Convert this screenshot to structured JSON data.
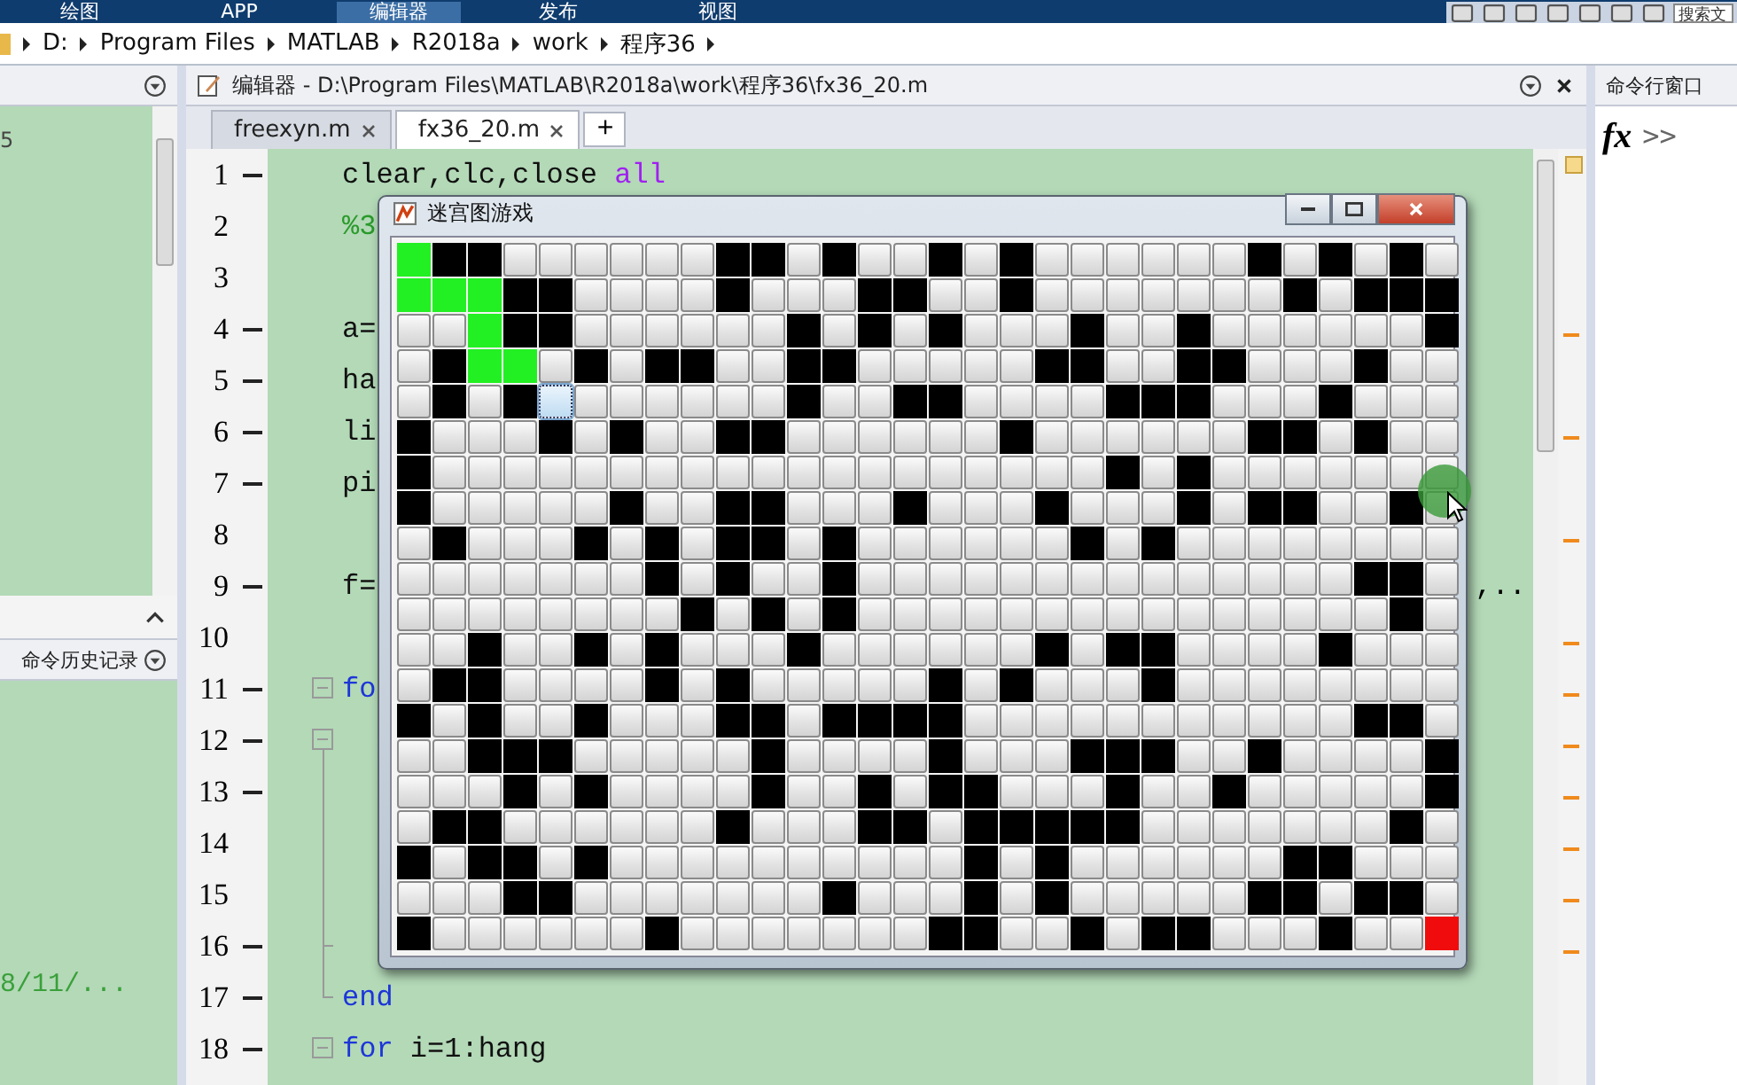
{
  "ribbon": {
    "tabs": [
      {
        "label": "绘图",
        "selected": false
      },
      {
        "label": "APP",
        "selected": false
      },
      {
        "label": "编辑器",
        "selected": true
      },
      {
        "label": "发布",
        "selected": false
      },
      {
        "label": "视图",
        "selected": false
      }
    ],
    "search": {
      "placeholder": "搜索文"
    }
  },
  "address_bar": {
    "segments": [
      "D:",
      "Program Files",
      "MATLAB",
      "R2018a",
      "work",
      "程序36"
    ]
  },
  "current_folder": {
    "texts": [
      "5"
    ]
  },
  "command_history": {
    "title": "命令历史记录",
    "texts": [
      "8/11/..."
    ]
  },
  "editor": {
    "title": "编辑器 - D:\\Program Files\\MATLAB\\R2018a\\work\\程序36\\fx36_20.m",
    "tabs": [
      {
        "label": "freexyn.m",
        "selected": false
      },
      {
        "label": "fx36_20.m",
        "selected": true
      }
    ],
    "add_tab": "+",
    "lines": [
      {
        "number": "1",
        "executable": true,
        "tokens": [
          {
            "kind": "plain",
            "text": "clear,clc,close "
          },
          {
            "kind": "string",
            "text": "all"
          }
        ]
      },
      {
        "number": "2",
        "executable": false,
        "tokens": [
          {
            "kind": "comment",
            "text": "%3"
          }
        ]
      },
      {
        "number": "3",
        "executable": false
      },
      {
        "number": "4",
        "executable": true,
        "tokens": [
          {
            "kind": "plain",
            "text": "a="
          }
        ]
      },
      {
        "number": "5",
        "executable": true,
        "tokens": [
          {
            "kind": "plain",
            "text": "ha"
          }
        ]
      },
      {
        "number": "6",
        "executable": true,
        "tokens": [
          {
            "kind": "plain",
            "text": "li"
          }
        ]
      },
      {
        "number": "7",
        "executable": true,
        "tokens": [
          {
            "kind": "plain",
            "text": "pi"
          }
        ]
      },
      {
        "number": "8",
        "executable": false
      },
      {
        "number": "9",
        "executable": true,
        "tokens": [
          {
            "kind": "plain",
            "text": "f="
          }
        ],
        "tail": ",.."
      },
      {
        "number": "10",
        "executable": false
      },
      {
        "number": "11",
        "executable": true,
        "kind": "fold_start",
        "tokens": [
          {
            "kind": "keyword",
            "text": "fo"
          }
        ]
      },
      {
        "number": "12",
        "executable": true,
        "kind": "fold_start"
      },
      {
        "number": "13",
        "executable": true,
        "kind": "fold_line"
      },
      {
        "number": "14",
        "executable": false,
        "kind": "fold_line"
      },
      {
        "number": "15",
        "executable": false,
        "kind": "fold_line"
      },
      {
        "number": "16",
        "executable": true,
        "kind": "fold_branch"
      },
      {
        "number": "17",
        "executable": true,
        "kind": "fold_end",
        "tokens": [
          {
            "kind": "keyword",
            "text": "end"
          }
        ]
      },
      {
        "number": "18",
        "executable": true,
        "kind": "fold_start",
        "tokens": [
          {
            "kind": "keyword",
            "text": "for"
          },
          {
            "kind": "plain",
            "text": " i=1:hang"
          }
        ]
      }
    ]
  },
  "command_window": {
    "title": "命令行窗口",
    "fx": "fx",
    "prompt": ">>"
  },
  "maze_window": {
    "title": "迷宫图游戏",
    "rows": [
      {
        "cells": [
          {
            "kind": "visited"
          },
          {
            "kind": "wall"
          },
          {
            "kind": "wall"
          },
          {
            "kind": "open"
          },
          {
            "kind": "open"
          },
          {
            "kind": "open"
          },
          {
            "kind": "open"
          },
          {
            "kind": "open"
          },
          {
            "kind": "open"
          },
          {
            "kind": "wall"
          },
          {
            "kind": "wall"
          },
          {
            "kind": "open"
          },
          {
            "kind": "wall"
          },
          {
            "kind": "open"
          },
          {
            "kind": "open"
          },
          {
            "kind": "wall"
          },
          {
            "kind": "open"
          },
          {
            "kind": "wall"
          },
          {
            "kind": "open"
          },
          {
            "kind": "open"
          },
          {
            "kind": "open"
          },
          {
            "kind": "open"
          },
          {
            "kind": "open"
          },
          {
            "kind": "open"
          },
          {
            "kind": "wall"
          },
          {
            "kind": "open"
          },
          {
            "kind": "wall"
          },
          {
            "kind": "open"
          },
          {
            "kind": "wall"
          },
          {
            "kind": "open"
          }
        ]
      },
      {
        "cells": [
          {
            "kind": "visited"
          },
          {
            "kind": "visited"
          },
          {
            "kind": "visited"
          },
          {
            "kind": "wall"
          },
          {
            "kind": "wall"
          },
          {
            "kind": "open"
          },
          {
            "kind": "open"
          },
          {
            "kind": "open"
          },
          {
            "kind": "open"
          },
          {
            "kind": "wall"
          },
          {
            "kind": "open"
          },
          {
            "kind": "open"
          },
          {
            "kind": "open"
          },
          {
            "kind": "wall"
          },
          {
            "kind": "wall"
          },
          {
            "kind": "open"
          },
          {
            "kind": "open"
          },
          {
            "kind": "wall"
          },
          {
            "kind": "open"
          },
          {
            "kind": "open"
          },
          {
            "kind": "open"
          },
          {
            "kind": "open"
          },
          {
            "kind": "open"
          },
          {
            "kind": "open"
          },
          {
            "kind": "open"
          },
          {
            "kind": "wall"
          },
          {
            "kind": "open"
          },
          {
            "kind": "wall"
          },
          {
            "kind": "wall"
          },
          {
            "kind": "wall"
          }
        ]
      },
      {
        "cells": [
          {
            "kind": "open"
          },
          {
            "kind": "open"
          },
          {
            "kind": "visited"
          },
          {
            "kind": "wall"
          },
          {
            "kind": "wall"
          },
          {
            "kind": "open"
          },
          {
            "kind": "open"
          },
          {
            "kind": "open"
          },
          {
            "kind": "open"
          },
          {
            "kind": "open"
          },
          {
            "kind": "open"
          },
          {
            "kind": "wall"
          },
          {
            "kind": "open"
          },
          {
            "kind": "wall"
          },
          {
            "kind": "open"
          },
          {
            "kind": "wall"
          },
          {
            "kind": "open"
          },
          {
            "kind": "open"
          },
          {
            "kind": "open"
          },
          {
            "kind": "wall"
          },
          {
            "kind": "open"
          },
          {
            "kind": "open"
          },
          {
            "kind": "wall"
          },
          {
            "kind": "open"
          },
          {
            "kind": "open"
          },
          {
            "kind": "open"
          },
          {
            "kind": "open"
          },
          {
            "kind": "open"
          },
          {
            "kind": "open"
          },
          {
            "kind": "wall"
          }
        ]
      },
      {
        "cells": [
          {
            "kind": "open"
          },
          {
            "kind": "wall"
          },
          {
            "kind": "visited"
          },
          {
            "kind": "visited"
          },
          {
            "kind": "open"
          },
          {
            "kind": "wall"
          },
          {
            "kind": "open"
          },
          {
            "kind": "wall"
          },
          {
            "kind": "wall"
          },
          {
            "kind": "open"
          },
          {
            "kind": "open"
          },
          {
            "kind": "wall"
          },
          {
            "kind": "wall"
          },
          {
            "kind": "open"
          },
          {
            "kind": "open"
          },
          {
            "kind": "open"
          },
          {
            "kind": "open"
          },
          {
            "kind": "open"
          },
          {
            "kind": "wall"
          },
          {
            "kind": "wall"
          },
          {
            "kind": "open"
          },
          {
            "kind": "open"
          },
          {
            "kind": "wall"
          },
          {
            "kind": "wall"
          },
          {
            "kind": "open"
          },
          {
            "kind": "open"
          },
          {
            "kind": "open"
          },
          {
            "kind": "wall"
          },
          {
            "kind": "open"
          },
          {
            "kind": "open"
          }
        ]
      },
      {
        "cells": [
          {
            "kind": "open"
          },
          {
            "kind": "wall"
          },
          {
            "kind": "open"
          },
          {
            "kind": "wall"
          },
          {
            "kind": "focused"
          },
          {
            "kind": "open"
          },
          {
            "kind": "open"
          },
          {
            "kind": "open"
          },
          {
            "kind": "open"
          },
          {
            "kind": "open"
          },
          {
            "kind": "open"
          },
          {
            "kind": "wall"
          },
          {
            "kind": "open"
          },
          {
            "kind": "open"
          },
          {
            "kind": "wall"
          },
          {
            "kind": "wall"
          },
          {
            "kind": "open"
          },
          {
            "kind": "open"
          },
          {
            "kind": "open"
          },
          {
            "kind": "open"
          },
          {
            "kind": "wall"
          },
          {
            "kind": "wall"
          },
          {
            "kind": "wall"
          },
          {
            "kind": "open"
          },
          {
            "kind": "open"
          },
          {
            "kind": "open"
          },
          {
            "kind": "wall"
          },
          {
            "kind": "open"
          },
          {
            "kind": "open"
          },
          {
            "kind": "open"
          }
        ]
      },
      {
        "cells": [
          {
            "kind": "wall"
          },
          {
            "kind": "open"
          },
          {
            "kind": "open"
          },
          {
            "kind": "open"
          },
          {
            "kind": "wall"
          },
          {
            "kind": "open"
          },
          {
            "kind": "wall"
          },
          {
            "kind": "open"
          },
          {
            "kind": "open"
          },
          {
            "kind": "wall"
          },
          {
            "kind": "wall"
          },
          {
            "kind": "open"
          },
          {
            "kind": "open"
          },
          {
            "kind": "open"
          },
          {
            "kind": "open"
          },
          {
            "kind": "open"
          },
          {
            "kind": "open"
          },
          {
            "kind": "wall"
          },
          {
            "kind": "open"
          },
          {
            "kind": "open"
          },
          {
            "kind": "open"
          },
          {
            "kind": "open"
          },
          {
            "kind": "open"
          },
          {
            "kind": "open"
          },
          {
            "kind": "wall"
          },
          {
            "kind": "wall"
          },
          {
            "kind": "open"
          },
          {
            "kind": "wall"
          },
          {
            "kind": "open"
          },
          {
            "kind": "open"
          }
        ]
      },
      {
        "cells": [
          {
            "kind": "wall"
          },
          {
            "kind": "open"
          },
          {
            "kind": "open"
          },
          {
            "kind": "open"
          },
          {
            "kind": "open"
          },
          {
            "kind": "open"
          },
          {
            "kind": "open"
          },
          {
            "kind": "open"
          },
          {
            "kind": "open"
          },
          {
            "kind": "open"
          },
          {
            "kind": "open"
          },
          {
            "kind": "open"
          },
          {
            "kind": "open"
          },
          {
            "kind": "open"
          },
          {
            "kind": "open"
          },
          {
            "kind": "open"
          },
          {
            "kind": "open"
          },
          {
            "kind": "open"
          },
          {
            "kind": "open"
          },
          {
            "kind": "open"
          },
          {
            "kind": "wall"
          },
          {
            "kind": "open"
          },
          {
            "kind": "wall"
          },
          {
            "kind": "open"
          },
          {
            "kind": "open"
          },
          {
            "kind": "open"
          },
          {
            "kind": "open"
          },
          {
            "kind": "open"
          },
          {
            "kind": "open"
          },
          {
            "kind": "open"
          }
        ]
      },
      {
        "cells": [
          {
            "kind": "wall"
          },
          {
            "kind": "open"
          },
          {
            "kind": "open"
          },
          {
            "kind": "open"
          },
          {
            "kind": "open"
          },
          {
            "kind": "open"
          },
          {
            "kind": "wall"
          },
          {
            "kind": "open"
          },
          {
            "kind": "open"
          },
          {
            "kind": "wall"
          },
          {
            "kind": "wall"
          },
          {
            "kind": "open"
          },
          {
            "kind": "open"
          },
          {
            "kind": "open"
          },
          {
            "kind": "wall"
          },
          {
            "kind": "open"
          },
          {
            "kind": "open"
          },
          {
            "kind": "open"
          },
          {
            "kind": "wall"
          },
          {
            "kind": "open"
          },
          {
            "kind": "open"
          },
          {
            "kind": "open"
          },
          {
            "kind": "wall"
          },
          {
            "kind": "open"
          },
          {
            "kind": "wall"
          },
          {
            "kind": "wall"
          },
          {
            "kind": "open"
          },
          {
            "kind": "open"
          },
          {
            "kind": "wall"
          },
          {
            "kind": "open"
          }
        ]
      },
      {
        "cells": [
          {
            "kind": "open"
          },
          {
            "kind": "wall"
          },
          {
            "kind": "open"
          },
          {
            "kind": "open"
          },
          {
            "kind": "open"
          },
          {
            "kind": "wall"
          },
          {
            "kind": "open"
          },
          {
            "kind": "wall"
          },
          {
            "kind": "open"
          },
          {
            "kind": "wall"
          },
          {
            "kind": "wall"
          },
          {
            "kind": "open"
          },
          {
            "kind": "wall"
          },
          {
            "kind": "open"
          },
          {
            "kind": "open"
          },
          {
            "kind": "open"
          },
          {
            "kind": "open"
          },
          {
            "kind": "open"
          },
          {
            "kind": "open"
          },
          {
            "kind": "wall"
          },
          {
            "kind": "open"
          },
          {
            "kind": "wall"
          },
          {
            "kind": "open"
          },
          {
            "kind": "open"
          },
          {
            "kind": "open"
          },
          {
            "kind": "open"
          },
          {
            "kind": "open"
          },
          {
            "kind": "open"
          },
          {
            "kind": "open"
          },
          {
            "kind": "open"
          }
        ]
      },
      {
        "cells": [
          {
            "kind": "open"
          },
          {
            "kind": "open"
          },
          {
            "kind": "open"
          },
          {
            "kind": "open"
          },
          {
            "kind": "open"
          },
          {
            "kind": "open"
          },
          {
            "kind": "open"
          },
          {
            "kind": "wall"
          },
          {
            "kind": "open"
          },
          {
            "kind": "wall"
          },
          {
            "kind": "open"
          },
          {
            "kind": "open"
          },
          {
            "kind": "wall"
          },
          {
            "kind": "open"
          },
          {
            "kind": "open"
          },
          {
            "kind": "open"
          },
          {
            "kind": "open"
          },
          {
            "kind": "open"
          },
          {
            "kind": "open"
          },
          {
            "kind": "open"
          },
          {
            "kind": "open"
          },
          {
            "kind": "open"
          },
          {
            "kind": "open"
          },
          {
            "kind": "open"
          },
          {
            "kind": "open"
          },
          {
            "kind": "open"
          },
          {
            "kind": "open"
          },
          {
            "kind": "wall"
          },
          {
            "kind": "wall"
          },
          {
            "kind": "open"
          }
        ]
      },
      {
        "cells": [
          {
            "kind": "open"
          },
          {
            "kind": "open"
          },
          {
            "kind": "open"
          },
          {
            "kind": "open"
          },
          {
            "kind": "open"
          },
          {
            "kind": "open"
          },
          {
            "kind": "open"
          },
          {
            "kind": "open"
          },
          {
            "kind": "wall"
          },
          {
            "kind": "open"
          },
          {
            "kind": "wall"
          },
          {
            "kind": "open"
          },
          {
            "kind": "wall"
          },
          {
            "kind": "open"
          },
          {
            "kind": "open"
          },
          {
            "kind": "open"
          },
          {
            "kind": "open"
          },
          {
            "kind": "open"
          },
          {
            "kind": "open"
          },
          {
            "kind": "open"
          },
          {
            "kind": "open"
          },
          {
            "kind": "open"
          },
          {
            "kind": "open"
          },
          {
            "kind": "open"
          },
          {
            "kind": "open"
          },
          {
            "kind": "open"
          },
          {
            "kind": "open"
          },
          {
            "kind": "open"
          },
          {
            "kind": "wall"
          },
          {
            "kind": "open"
          }
        ]
      },
      {
        "cells": [
          {
            "kind": "open"
          },
          {
            "kind": "open"
          },
          {
            "kind": "wall"
          },
          {
            "kind": "open"
          },
          {
            "kind": "open"
          },
          {
            "kind": "wall"
          },
          {
            "kind": "open"
          },
          {
            "kind": "wall"
          },
          {
            "kind": "open"
          },
          {
            "kind": "open"
          },
          {
            "kind": "open"
          },
          {
            "kind": "wall"
          },
          {
            "kind": "open"
          },
          {
            "kind": "open"
          },
          {
            "kind": "open"
          },
          {
            "kind": "open"
          },
          {
            "kind": "open"
          },
          {
            "kind": "open"
          },
          {
            "kind": "wall"
          },
          {
            "kind": "open"
          },
          {
            "kind": "wall"
          },
          {
            "kind": "wall"
          },
          {
            "kind": "open"
          },
          {
            "kind": "open"
          },
          {
            "kind": "open"
          },
          {
            "kind": "open"
          },
          {
            "kind": "wall"
          },
          {
            "kind": "open"
          },
          {
            "kind": "open"
          },
          {
            "kind": "open"
          }
        ]
      },
      {
        "cells": [
          {
            "kind": "open"
          },
          {
            "kind": "wall"
          },
          {
            "kind": "wall"
          },
          {
            "kind": "open"
          },
          {
            "kind": "open"
          },
          {
            "kind": "open"
          },
          {
            "kind": "open"
          },
          {
            "kind": "wall"
          },
          {
            "kind": "open"
          },
          {
            "kind": "wall"
          },
          {
            "kind": "open"
          },
          {
            "kind": "open"
          },
          {
            "kind": "open"
          },
          {
            "kind": "open"
          },
          {
            "kind": "open"
          },
          {
            "kind": "wall"
          },
          {
            "kind": "open"
          },
          {
            "kind": "wall"
          },
          {
            "kind": "open"
          },
          {
            "kind": "open"
          },
          {
            "kind": "open"
          },
          {
            "kind": "wall"
          },
          {
            "kind": "open"
          },
          {
            "kind": "open"
          },
          {
            "kind": "open"
          },
          {
            "kind": "open"
          },
          {
            "kind": "open"
          },
          {
            "kind": "open"
          },
          {
            "kind": "open"
          },
          {
            "kind": "open"
          }
        ]
      },
      {
        "cells": [
          {
            "kind": "wall"
          },
          {
            "kind": "open"
          },
          {
            "kind": "wall"
          },
          {
            "kind": "open"
          },
          {
            "kind": "open"
          },
          {
            "kind": "wall"
          },
          {
            "kind": "open"
          },
          {
            "kind": "open"
          },
          {
            "kind": "open"
          },
          {
            "kind": "wall"
          },
          {
            "kind": "wall"
          },
          {
            "kind": "open"
          },
          {
            "kind": "wall"
          },
          {
            "kind": "wall"
          },
          {
            "kind": "wall"
          },
          {
            "kind": "wall"
          },
          {
            "kind": "open"
          },
          {
            "kind": "open"
          },
          {
            "kind": "open"
          },
          {
            "kind": "open"
          },
          {
            "kind": "open"
          },
          {
            "kind": "open"
          },
          {
            "kind": "open"
          },
          {
            "kind": "open"
          },
          {
            "kind": "open"
          },
          {
            "kind": "open"
          },
          {
            "kind": "open"
          },
          {
            "kind": "wall"
          },
          {
            "kind": "wall"
          },
          {
            "kind": "open"
          }
        ]
      },
      {
        "cells": [
          {
            "kind": "open"
          },
          {
            "kind": "open"
          },
          {
            "kind": "wall"
          },
          {
            "kind": "wall"
          },
          {
            "kind": "wall"
          },
          {
            "kind": "open"
          },
          {
            "kind": "open"
          },
          {
            "kind": "open"
          },
          {
            "kind": "open"
          },
          {
            "kind": "open"
          },
          {
            "kind": "wall"
          },
          {
            "kind": "open"
          },
          {
            "kind": "open"
          },
          {
            "kind": "open"
          },
          {
            "kind": "open"
          },
          {
            "kind": "wall"
          },
          {
            "kind": "open"
          },
          {
            "kind": "open"
          },
          {
            "kind": "open"
          },
          {
            "kind": "wall"
          },
          {
            "kind": "wall"
          },
          {
            "kind": "wall"
          },
          {
            "kind": "open"
          },
          {
            "kind": "open"
          },
          {
            "kind": "wall"
          },
          {
            "kind": "open"
          },
          {
            "kind": "open"
          },
          {
            "kind": "open"
          },
          {
            "kind": "open"
          },
          {
            "kind": "wall"
          }
        ]
      },
      {
        "cells": [
          {
            "kind": "open"
          },
          {
            "kind": "open"
          },
          {
            "kind": "open"
          },
          {
            "kind": "wall"
          },
          {
            "kind": "open"
          },
          {
            "kind": "wall"
          },
          {
            "kind": "open"
          },
          {
            "kind": "open"
          },
          {
            "kind": "open"
          },
          {
            "kind": "open"
          },
          {
            "kind": "wall"
          },
          {
            "kind": "open"
          },
          {
            "kind": "open"
          },
          {
            "kind": "wall"
          },
          {
            "kind": "open"
          },
          {
            "kind": "wall"
          },
          {
            "kind": "wall"
          },
          {
            "kind": "open"
          },
          {
            "kind": "open"
          },
          {
            "kind": "open"
          },
          {
            "kind": "wall"
          },
          {
            "kind": "open"
          },
          {
            "kind": "open"
          },
          {
            "kind": "wall"
          },
          {
            "kind": "open"
          },
          {
            "kind": "open"
          },
          {
            "kind": "open"
          },
          {
            "kind": "open"
          },
          {
            "kind": "open"
          },
          {
            "kind": "wall"
          }
        ]
      },
      {
        "cells": [
          {
            "kind": "open"
          },
          {
            "kind": "wall"
          },
          {
            "kind": "wall"
          },
          {
            "kind": "open"
          },
          {
            "kind": "open"
          },
          {
            "kind": "open"
          },
          {
            "kind": "open"
          },
          {
            "kind": "open"
          },
          {
            "kind": "open"
          },
          {
            "kind": "wall"
          },
          {
            "kind": "open"
          },
          {
            "kind": "open"
          },
          {
            "kind": "open"
          },
          {
            "kind": "wall"
          },
          {
            "kind": "wall"
          },
          {
            "kind": "open"
          },
          {
            "kind": "wall"
          },
          {
            "kind": "wall"
          },
          {
            "kind": "wall"
          },
          {
            "kind": "wall"
          },
          {
            "kind": "wall"
          },
          {
            "kind": "open"
          },
          {
            "kind": "open"
          },
          {
            "kind": "open"
          },
          {
            "kind": "open"
          },
          {
            "kind": "open"
          },
          {
            "kind": "open"
          },
          {
            "kind": "open"
          },
          {
            "kind": "wall"
          },
          {
            "kind": "open"
          }
        ]
      },
      {
        "cells": [
          {
            "kind": "wall"
          },
          {
            "kind": "open"
          },
          {
            "kind": "wall"
          },
          {
            "kind": "wall"
          },
          {
            "kind": "open"
          },
          {
            "kind": "wall"
          },
          {
            "kind": "open"
          },
          {
            "kind": "open"
          },
          {
            "kind": "open"
          },
          {
            "kind": "open"
          },
          {
            "kind": "open"
          },
          {
            "kind": "open"
          },
          {
            "kind": "open"
          },
          {
            "kind": "open"
          },
          {
            "kind": "open"
          },
          {
            "kind": "open"
          },
          {
            "kind": "wall"
          },
          {
            "kind": "open"
          },
          {
            "kind": "wall"
          },
          {
            "kind": "open"
          },
          {
            "kind": "open"
          },
          {
            "kind": "open"
          },
          {
            "kind": "open"
          },
          {
            "kind": "open"
          },
          {
            "kind": "open"
          },
          {
            "kind": "wall"
          },
          {
            "kind": "wall"
          },
          {
            "kind": "open"
          },
          {
            "kind": "open"
          },
          {
            "kind": "open"
          }
        ]
      },
      {
        "cells": [
          {
            "kind": "open"
          },
          {
            "kind": "open"
          },
          {
            "kind": "open"
          },
          {
            "kind": "wall"
          },
          {
            "kind": "wall"
          },
          {
            "kind": "open"
          },
          {
            "kind": "open"
          },
          {
            "kind": "open"
          },
          {
            "kind": "open"
          },
          {
            "kind": "open"
          },
          {
            "kind": "open"
          },
          {
            "kind": "open"
          },
          {
            "kind": "wall"
          },
          {
            "kind": "open"
          },
          {
            "kind": "open"
          },
          {
            "kind": "open"
          },
          {
            "kind": "wall"
          },
          {
            "kind": "open"
          },
          {
            "kind": "wall"
          },
          {
            "kind": "open"
          },
          {
            "kind": "open"
          },
          {
            "kind": "open"
          },
          {
            "kind": "open"
          },
          {
            "kind": "open"
          },
          {
            "kind": "wall"
          },
          {
            "kind": "wall"
          },
          {
            "kind": "open"
          },
          {
            "kind": "wall"
          },
          {
            "kind": "wall"
          },
          {
            "kind": "open"
          }
        ]
      },
      {
        "cells": [
          {
            "kind": "wall"
          },
          {
            "kind": "open"
          },
          {
            "kind": "open"
          },
          {
            "kind": "open"
          },
          {
            "kind": "open"
          },
          {
            "kind": "open"
          },
          {
            "kind": "open"
          },
          {
            "kind": "wall"
          },
          {
            "kind": "open"
          },
          {
            "kind": "open"
          },
          {
            "kind": "open"
          },
          {
            "kind": "open"
          },
          {
            "kind": "open"
          },
          {
            "kind": "open"
          },
          {
            "kind": "open"
          },
          {
            "kind": "wall"
          },
          {
            "kind": "wall"
          },
          {
            "kind": "open"
          },
          {
            "kind": "open"
          },
          {
            "kind": "wall"
          },
          {
            "kind": "open"
          },
          {
            "kind": "wall"
          },
          {
            "kind": "wall"
          },
          {
            "kind": "open"
          },
          {
            "kind": "open"
          },
          {
            "kind": "open"
          },
          {
            "kind": "wall"
          },
          {
            "kind": "open"
          },
          {
            "kind": "open"
          },
          {
            "kind": "goal"
          }
        ]
      }
    ]
  }
}
